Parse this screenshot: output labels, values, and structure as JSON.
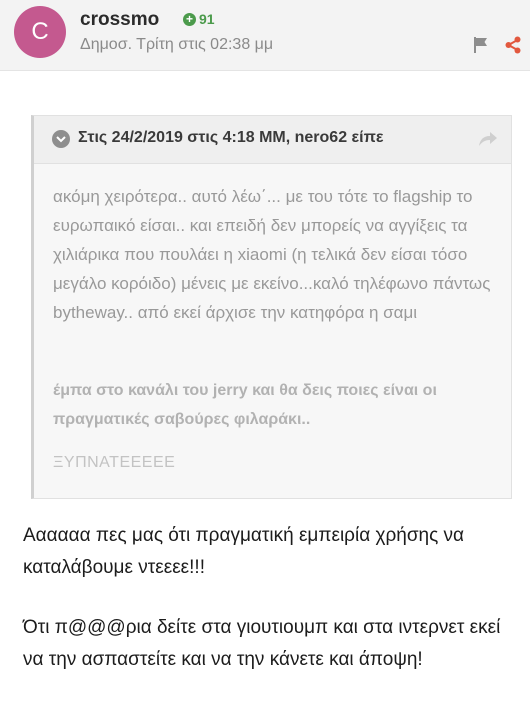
{
  "post": {
    "avatar_letter": "C",
    "avatar_color": "#c4598f",
    "author": "crossmo",
    "reputation": "91",
    "posted": "Δημοσ. Τρίτη στις 02:38 μμ",
    "icons": {
      "flag": "flag-icon",
      "share": "share-icon"
    }
  },
  "quote": {
    "cite": "Στις 24/2/2019 στις 4:18 ΜΜ, nero62 είπε",
    "text": "ακόμη χειρότερα.. αυτό λέω΄... με του τότε το flagship το ευρωπαικό είσαι.. και επειδή δεν μπορείς να αγγίξεις τα χιλιάρικα που πουλάει η xiaomi (η τελικά δεν είσαι τόσο μεγάλο κορόιδο) μένεις με εκείνο...καλό τηλέφωνο πάντως bytheway.. από εκεί άρχισε την κατηφόρα η σαμι",
    "bold_text": "έμπα στο κανάλι του jerry και θα δεις ποιες είναι οι πραγματικές σαβούρες φιλαράκι..",
    "shout": "ΞΥΠΝΑΤΕΕΕΕΕ"
  },
  "reply": {
    "p1": "Αααααα πες μας ότι  πραγματική εμπειρία χρήσης να καταλάβουμε ντεεεε!!!",
    "p2": "Ότι π@@@ρια δείτε στα γιουτιουμπ και στα ιντερνετ εκεί να την ασπαστείτε και να την κάνετε και άποψη!"
  }
}
